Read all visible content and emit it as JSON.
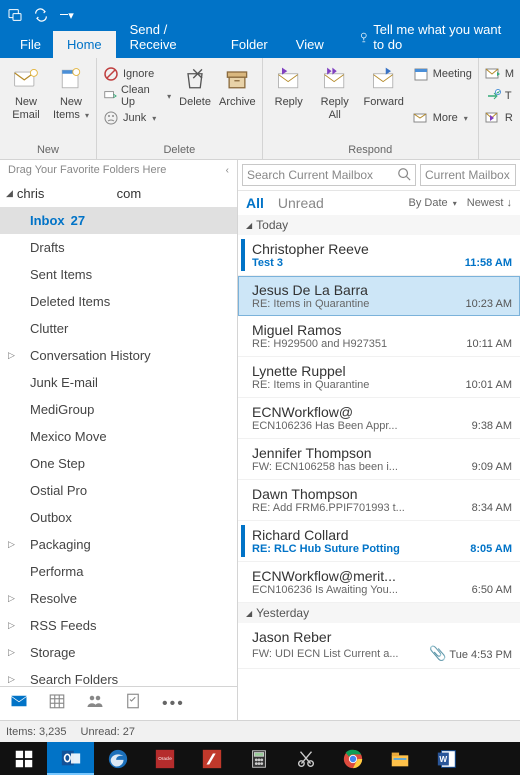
{
  "titlebar": {
    "icons": [
      "app",
      "send-receive",
      "dropdown"
    ]
  },
  "menu": {
    "file": "File",
    "home": "Home",
    "sendreceive": "Send / Receive",
    "folder": "Folder",
    "view": "View",
    "tellme": "Tell me what you want to do"
  },
  "ribbon": {
    "new": {
      "label": "New",
      "new_email": "New\nEmail",
      "new_items": "New\nItems"
    },
    "delete_group": {
      "label": "Delete",
      "ignore": "Ignore",
      "cleanup": "Clean Up",
      "junk": "Junk",
      "delete": "Delete",
      "archive": "Archive"
    },
    "respond": {
      "label": "Respond",
      "reply": "Reply",
      "reply_all": "Reply\nAll",
      "forward": "Forward",
      "meeting": "Meeting",
      "more": "More"
    },
    "extra": {
      "m": "M",
      "t": "T",
      "r": "R"
    }
  },
  "folderpane": {
    "favorites_hint": "Drag Your Favorite Folders Here",
    "account": "chris                    com",
    "items": [
      {
        "label": "Inbox",
        "count": "27",
        "selected": true
      },
      {
        "label": "Drafts"
      },
      {
        "label": "Sent Items"
      },
      {
        "label": "Deleted Items"
      },
      {
        "label": "Clutter"
      },
      {
        "label": "Conversation History",
        "expandable": true
      },
      {
        "label": "Junk E-mail"
      },
      {
        "label": "MediGroup"
      },
      {
        "label": "Mexico Move"
      },
      {
        "label": "One Step"
      },
      {
        "label": "Ostial Pro"
      },
      {
        "label": "Outbox"
      },
      {
        "label": "Packaging",
        "expandable": true
      },
      {
        "label": "Performa"
      },
      {
        "label": "Resolve",
        "expandable": true
      },
      {
        "label": "RSS Feeds",
        "expandable": true
      },
      {
        "label": "Storage",
        "expandable": true
      },
      {
        "label": "Search Folders",
        "expandable": true
      }
    ]
  },
  "search": {
    "placeholder": "Search Current Mailbox",
    "scope": "Current Mailbox"
  },
  "filters": {
    "all": "All",
    "unread": "Unread",
    "bydate": "By Date",
    "newest": "Newest"
  },
  "groups": {
    "today": "Today",
    "yesterday": "Yesterday"
  },
  "messages_today": [
    {
      "from": "Christopher Reeve",
      "subj": "Test 3",
      "time": "11:58 AM",
      "unread": true
    },
    {
      "from": "Jesus De La Barra",
      "subj": "RE: Items in Quarantine",
      "time": "10:23 AM",
      "selected": true
    },
    {
      "from": "Miguel Ramos",
      "subj": "RE: H929500 and H927351",
      "time": "10:11 AM"
    },
    {
      "from": "Lynette Ruppel",
      "subj": "RE: Items in Quarantine",
      "time": "10:01 AM"
    },
    {
      "from": "ECNWorkflow@",
      "subj": "ECN106236 Has Been Appr...",
      "time": "9:38 AM"
    },
    {
      "from": "Jennifer Thompson",
      "subj": "FW: ECN106258 has been i...",
      "time": "9:09 AM"
    },
    {
      "from": "Dawn Thompson",
      "subj": "RE: Add FRM6.PPIF701993 t...",
      "time": "8:34 AM"
    },
    {
      "from": "Richard Collard",
      "subj": "RE: RLC Hub Suture Potting",
      "time": "8:05 AM",
      "unread": true
    },
    {
      "from": "ECNWorkflow@merit...",
      "subj": "ECN106236 Is Awaiting You...",
      "time": "6:50 AM"
    }
  ],
  "messages_yesterday": [
    {
      "from": "Jason Reber",
      "subj": "FW: UDI ECN List Current a...",
      "time": "Tue 4:53 PM",
      "attachment": true
    }
  ],
  "statusbar": {
    "items": "Items: 3,235",
    "unread": "Unread: 27"
  }
}
